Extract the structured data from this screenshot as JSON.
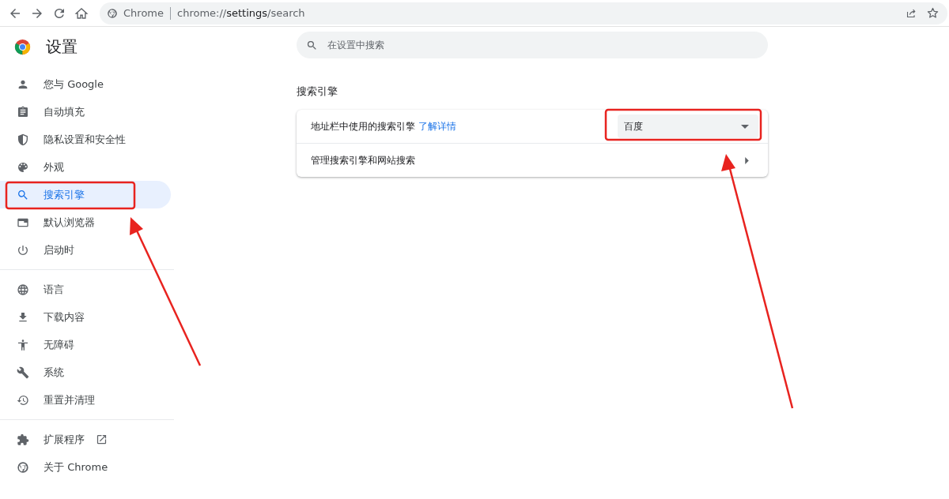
{
  "toolbar": {
    "site_label": "Chrome",
    "url": "chrome://**settings**/search"
  },
  "header": {
    "title": "设置"
  },
  "sidebar": {
    "groups": [
      {
        "items": [
          {
            "label": "您与 Google",
            "selected": false
          },
          {
            "label": "自动填充",
            "selected": false
          },
          {
            "label": "隐私设置和安全性",
            "selected": false
          },
          {
            "label": "外观",
            "selected": false
          },
          {
            "label": "搜索引擎",
            "selected": true
          },
          {
            "label": "默认浏览器",
            "selected": false
          },
          {
            "label": "启动时",
            "selected": false
          }
        ]
      },
      {
        "items": [
          {
            "label": "语言",
            "selected": false
          },
          {
            "label": "下载内容",
            "selected": false
          },
          {
            "label": "无障碍",
            "selected": false
          },
          {
            "label": "系统",
            "selected": false
          },
          {
            "label": "重置并清理",
            "selected": false
          }
        ]
      },
      {
        "items": [
          {
            "label": "扩展程序",
            "selected": false,
            "external": true
          },
          {
            "label": "关于 Chrome",
            "selected": false
          }
        ]
      }
    ]
  },
  "search": {
    "placeholder": "在设置中搜索"
  },
  "section": {
    "title": "搜索引擎",
    "rows": [
      {
        "kind": "select",
        "label": "地址栏中使用的搜索引擎",
        "link": "了解详情",
        "value": "百度"
      },
      {
        "kind": "nav",
        "label": "管理搜索引擎和网站搜索"
      }
    ]
  }
}
